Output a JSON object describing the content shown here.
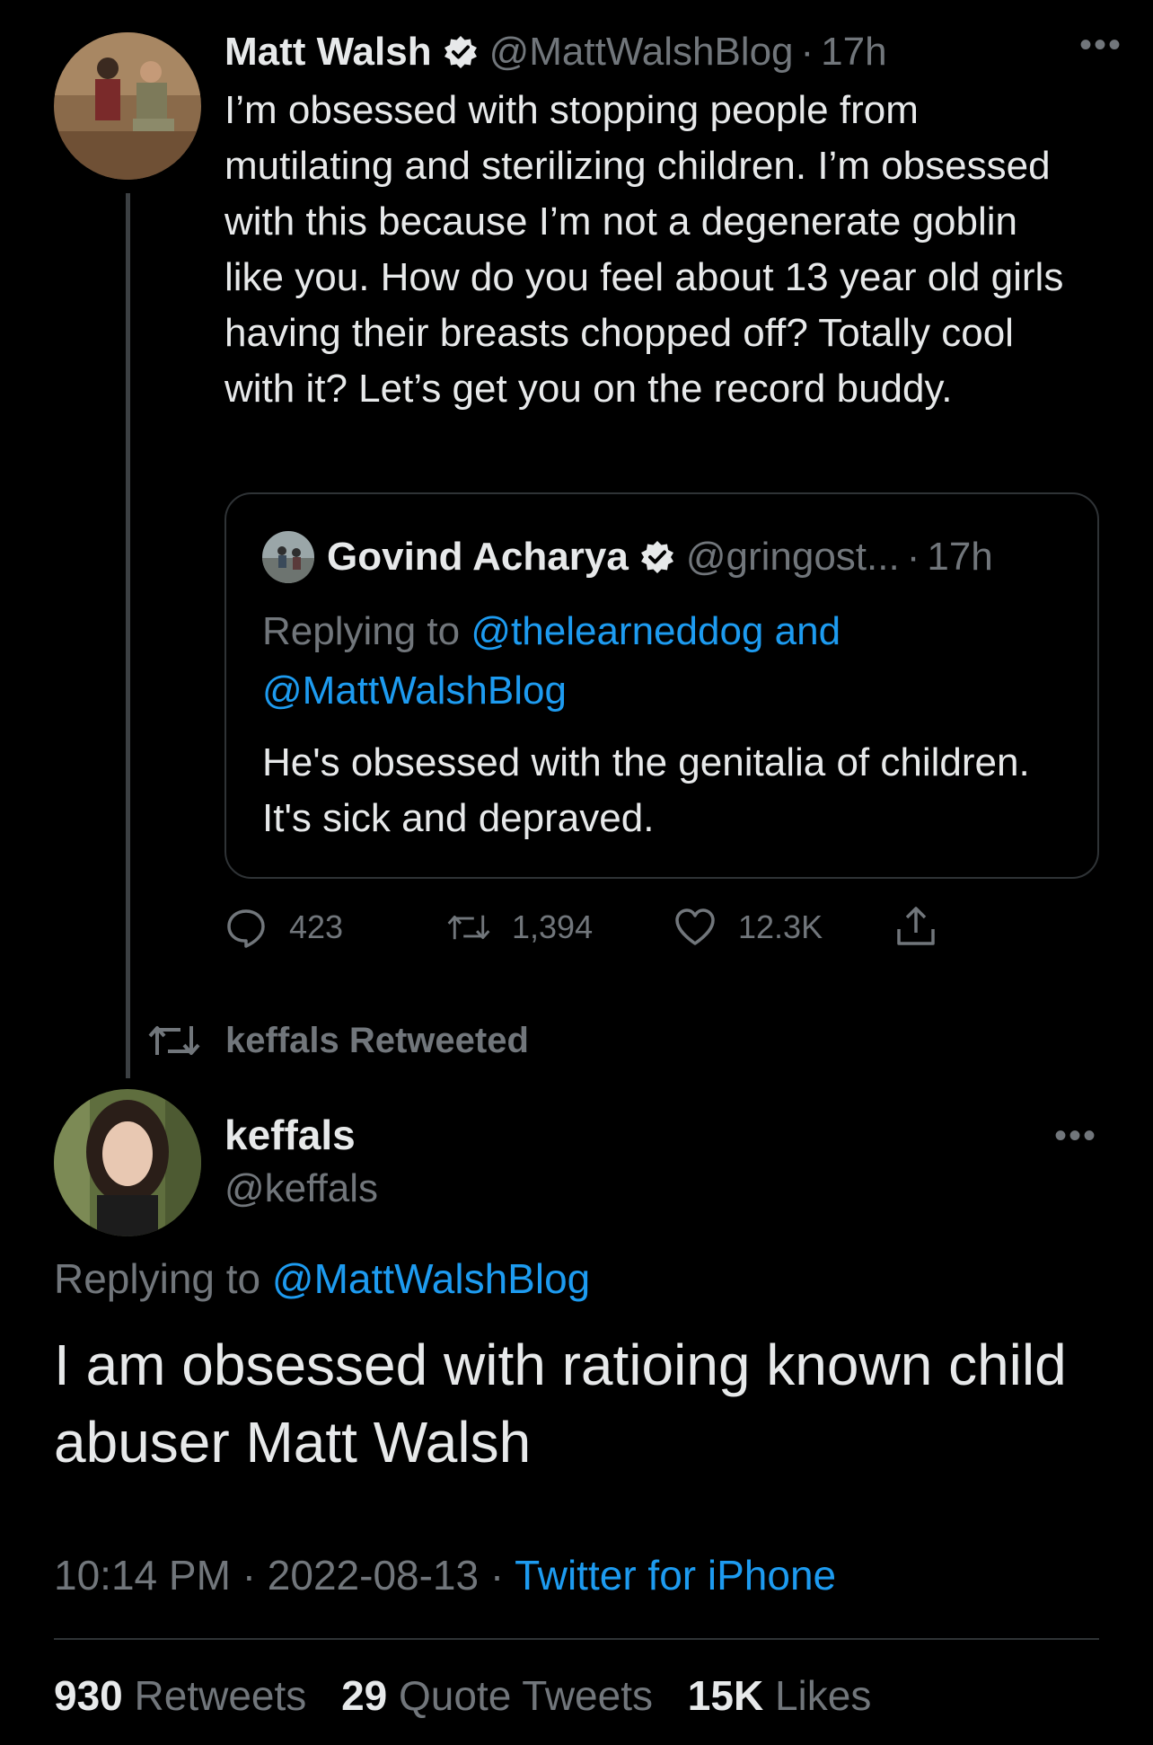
{
  "parent_tweet": {
    "name": "Matt Walsh",
    "handle": "@MattWalshBlog",
    "sep": "·",
    "time": "17h",
    "more_icon": "more-horizontal-icon",
    "text": "I’m obsessed with stopping people from mutilating and sterilizing children. I’m obsessed with this because I’m not a degenerate goblin like you. How do you feel about 13 year old girls having their breasts chopped off? Totally cool with it? Let’s get you on the record buddy.",
    "quote": {
      "name": "Govind Acharya",
      "handle": "@gringost...",
      "sep": "·",
      "time": "17h",
      "replying_label": "Replying to",
      "replying_to_1": "@thelearneddog",
      "replying_and": "and",
      "replying_to_2": "@MattWalshBlog",
      "text": "He's obsessed with the genitalia of children. It's sick and depraved."
    },
    "actions": {
      "replies": "423",
      "retweets": "1,394",
      "likes": "12.3K"
    }
  },
  "retweet_banner": {
    "text": "keffals Retweeted"
  },
  "main_tweet": {
    "name": "keffals",
    "handle": "@keffals",
    "replying_label": "Replying to",
    "replying_to": "@MattWalshBlog",
    "text": "I am obsessed with ratioing known child abuser Matt Walsh",
    "time": "10:14 PM",
    "date": "2022-08-13",
    "sep": "·",
    "source": "Twitter for iPhone",
    "stats": {
      "retweets_count": "930",
      "retweets_label": "Retweets",
      "quotes_count": "29",
      "quotes_label": "Quote Tweets",
      "likes_count": "15K",
      "likes_label": "Likes"
    }
  },
  "colors": {
    "background": "#000000",
    "text": "#e7e9ea",
    "muted": "#71767b",
    "link": "#1d9bf0",
    "border": "#2f3336"
  }
}
